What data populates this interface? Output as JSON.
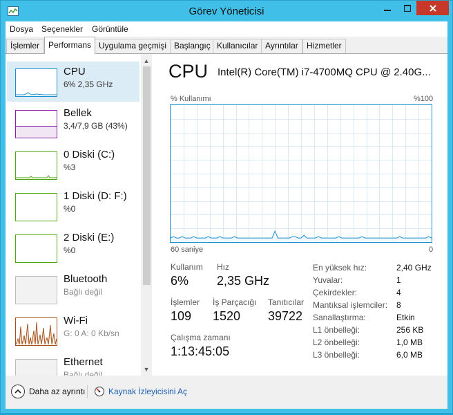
{
  "window": {
    "title": "Görev Yöneticisi"
  },
  "menu": [
    "Dosya",
    "Seçenekler",
    "Görüntüle"
  ],
  "tabs": [
    "İşlemler",
    "Performans",
    "Uygulama geçmişi",
    "Başlangıç",
    "Kullanıcılar",
    "Ayrıntılar",
    "Hizmetler"
  ],
  "active_tab": "Performans",
  "sidebar": [
    {
      "title": "CPU",
      "sub": "6% 2,35 GHz",
      "color": "#1a8fcf"
    },
    {
      "title": "Bellek",
      "sub": "3,4/7,9 GB (43%)",
      "color": "#8b1fa9"
    },
    {
      "title": "0 Diski (C:)",
      "sub": "%3",
      "color": "#4da60c"
    },
    {
      "title": "1 Diski (D: F:)",
      "sub": "%0",
      "color": "#4da60c"
    },
    {
      "title": "2 Diski (E:)",
      "sub": "%0",
      "color": "#4da60c"
    },
    {
      "title": "Bluetooth",
      "sub": "Bağlı değil",
      "color": "#a0a0a0"
    },
    {
      "title": "Wi-Fi",
      "sub": "G: 0 A: 0 Kb/sn",
      "color": "#a7521a"
    },
    {
      "title": "Ethernet",
      "sub": "Bağlı değil",
      "color": "#a0a0a0"
    }
  ],
  "detail": {
    "title": "CPU",
    "model": "Intel(R) Core(TM) i7-4700MQ CPU @ 2.40G...",
    "graph_top_left": "% Kullanımı",
    "graph_top_right": "%100",
    "graph_bottom_left": "60 saniye",
    "graph_bottom_right": "0",
    "utilization_label": "Kullanım",
    "utilization_value": "6%",
    "speed_label": "Hız",
    "speed_value": "2,35 GHz",
    "processes_label": "İşlemler",
    "processes_value": "109",
    "threads_label": "İş Parçacığı",
    "threads_value": "1520",
    "handles_label": "Tanıtıcılar",
    "handles_value": "39722",
    "uptime_label": "Çalışma zamanı",
    "uptime_value": "1:13:45:05",
    "specs": [
      {
        "key": "En yüksek hız:",
        "value": "2,40 GHz"
      },
      {
        "key": "Yuvalar:",
        "value": "1"
      },
      {
        "key": "Çekirdekler:",
        "value": "4"
      },
      {
        "key": "Mantıksal işlemciler:",
        "value": "8"
      },
      {
        "key": "Sanallaştırma:",
        "value": "Etkin"
      },
      {
        "key": "L1 önbelleği:",
        "value": "256 KB"
      },
      {
        "key": "L2 önbelleği:",
        "value": "1,0 MB"
      },
      {
        "key": "L3 önbelleği:",
        "value": "6,0 MB"
      }
    ]
  },
  "cpu_history_percent": [
    3,
    4,
    3,
    3,
    4,
    3,
    3,
    3,
    4,
    3,
    3,
    3,
    3,
    4,
    3,
    3,
    3,
    4,
    3,
    3,
    3,
    3,
    4,
    3,
    3,
    3,
    3,
    3,
    3,
    3,
    3,
    3,
    3,
    3,
    3,
    3,
    8,
    3,
    3,
    3,
    3,
    3,
    4,
    4,
    3,
    3,
    5,
    3,
    3,
    3,
    3,
    4,
    3,
    3,
    3,
    3,
    3,
    3,
    4,
    3,
    3,
    3,
    3,
    3,
    3,
    3,
    4,
    3,
    3,
    3,
    3,
    3,
    3,
    3,
    3,
    3,
    3,
    3,
    3,
    4,
    3,
    3,
    3,
    3,
    3,
    3,
    3,
    3,
    3,
    4,
    3
  ],
  "footer": {
    "less_details": "Daha az ayrıntı",
    "resource_monitor": "Kaynak İzleyicisini Aç"
  }
}
